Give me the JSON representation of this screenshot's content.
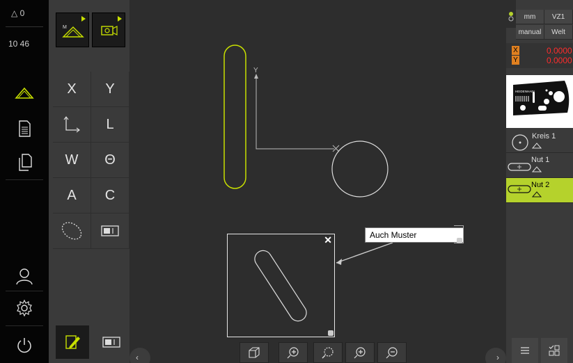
{
  "status": {
    "delta_label": "△ 0",
    "time": "10 46"
  },
  "nav": [
    {
      "icon": "measure-icon"
    },
    {
      "icon": "document-icon"
    },
    {
      "icon": "copy-documents-icon"
    },
    {
      "icon": "user-icon"
    },
    {
      "icon": "settings-gear-icon"
    },
    {
      "icon": "power-icon"
    }
  ],
  "functions": {
    "top": [
      {
        "icon": "manual-measure-icon",
        "mark": "M"
      },
      {
        "icon": "camera-icon"
      }
    ],
    "grid": [
      {
        "label": "X",
        "name": "x"
      },
      {
        "label": "Y",
        "name": "y"
      },
      {
        "label": "",
        "name": "coordinate-system"
      },
      {
        "label": "L",
        "name": "l"
      },
      {
        "label": "W",
        "name": "w"
      },
      {
        "label": "Θ",
        "name": "theta"
      },
      {
        "label": "A",
        "name": "a"
      },
      {
        "label": "C",
        "name": "c"
      },
      {
        "label": "",
        "name": "ellipse"
      },
      {
        "label": "",
        "name": "window"
      }
    ],
    "bottom": [
      {
        "icon": "edit-icon",
        "active": true
      },
      {
        "icon": "window-icon",
        "active": false
      }
    ]
  },
  "workspace": {
    "axis_y_label": "Y",
    "tag_text": "Auch Muster",
    "toolbar": [
      "3d-view-icon",
      "zoom-fit-icon",
      "zoom-window-icon",
      "zoom-in-icon",
      "zoom-out-icon"
    ]
  },
  "right": {
    "unit": "mm",
    "mode": "VZ1",
    "entry": "manual",
    "coord_system": "Welt",
    "positions": [
      {
        "axis": "X",
        "value": "0.0000"
      },
      {
        "axis": "Y",
        "value": "0.0000"
      }
    ],
    "preview_brand": "HEIDENHAIN",
    "features": [
      {
        "label": "Kreis 1",
        "icon": "circle-feature-icon",
        "active": false
      },
      {
        "label": "Nut 1",
        "icon": "slot-feature-icon",
        "active": false
      },
      {
        "label": "Nut 2",
        "icon": "slot-feature-icon",
        "active": true
      }
    ],
    "bottom": [
      "menu-icon",
      "checklist-icon"
    ]
  },
  "colors": {
    "accent": "#b5d22c",
    "position_value": "#ff2c2c",
    "axis_badge": "#e08020",
    "selection_outline": "#c8e000"
  }
}
